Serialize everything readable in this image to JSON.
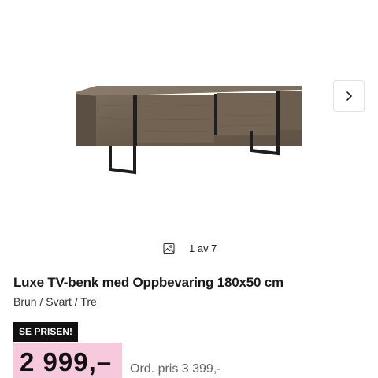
{
  "gallery": {
    "image_alt": "Luxe TV-benk med Oppbevaring 180x50 cm",
    "counter_text": "1 av 7",
    "next_icon": "chevron-right-icon",
    "gallery_icon": "image-icon"
  },
  "product": {
    "title": "Luxe TV-benk med Oppbevaring 180x50 cm",
    "variant": "Brun / Svart / Tre"
  },
  "price": {
    "badge": "SE PRISEN!",
    "current": "2 999,–",
    "original": "Ord. pris 3 399,-"
  },
  "colors": {
    "badge_bg": "#111111",
    "price_highlight": "#f7c9dd",
    "wood": "#6f6152",
    "legs": "#1e1e1e"
  }
}
